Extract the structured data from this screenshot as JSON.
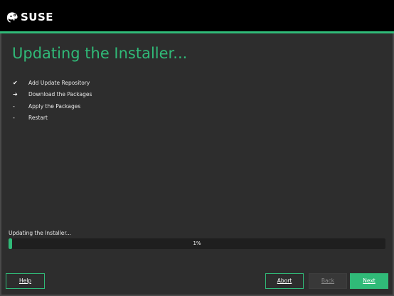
{
  "header": {
    "logo_text": "SUSE",
    "logo_icon": "suse-chameleon-icon",
    "accent_color": "#30ba78"
  },
  "page": {
    "title": "Updating the Installer..."
  },
  "steps": [
    {
      "mark": "✔",
      "status": "done",
      "label": "Add Update Repository"
    },
    {
      "mark": "➔",
      "status": "current",
      "label": "Download the Packages"
    },
    {
      "mark": "-",
      "status": "pending",
      "label": "Apply the Packages"
    },
    {
      "mark": "-",
      "status": "pending",
      "label": "Restart"
    }
  ],
  "progress": {
    "label": "Updating the Installer...",
    "percent": 1,
    "text": "1%"
  },
  "buttons": {
    "help": "Help",
    "abort": "Abort",
    "back": "Back",
    "next": "Next"
  }
}
